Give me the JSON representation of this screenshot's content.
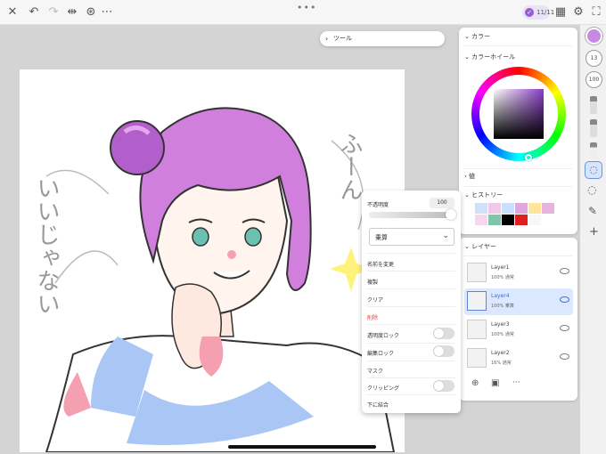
{
  "topbar": {
    "handle": "•••",
    "badge_label": "11/11",
    "icons": [
      "close-icon",
      "undo-icon",
      "redo-icon",
      "flip-icon",
      "filters-icon",
      "more-icon",
      "select-icon",
      "settings-icon",
      "fullscreen-icon"
    ]
  },
  "tools_panel": {
    "label": "ツール"
  },
  "color_panel": {
    "title": "カラー",
    "wheel_title": "カラーホイール",
    "values_title": "値",
    "history_title": "ヒストリー",
    "history_swatches": [
      "#cfe0f7",
      "#f0c9e8",
      "#c8dfff",
      "#e1a6dd",
      "#ffe69a",
      "#e7b4df",
      "#f7d6ee",
      "#7cc7a8",
      "#000000",
      "#e21f1f",
      "#f7f7f7"
    ]
  },
  "layers_panel": {
    "title": "レイヤー",
    "layers": [
      {
        "name": "Layer1",
        "meta": "100%   通常",
        "selected": false
      },
      {
        "name": "Layer4",
        "meta": "100%   乗算",
        "selected": true
      },
      {
        "name": "Layer3",
        "meta": "100%   通常",
        "selected": false
      },
      {
        "name": "Layer2",
        "meta": "16%   通常",
        "selected": false
      }
    ],
    "footer_more": "···"
  },
  "context_menu": {
    "opacity_label": "不透明度",
    "opacity_value": "100",
    "blend_mode": "乗算",
    "items": [
      "名前を変更",
      "複製",
      "クリア",
      "削除",
      "透明度ロック",
      "編集ロック",
      "マスク",
      "クリッピング",
      "下に結合"
    ]
  },
  "right_toolbar": {
    "size_value": "13",
    "opacity_value": "100",
    "add_label": "+"
  },
  "canvas_text": {
    "vertical_1": "ふーん",
    "vertical_2": "いいじゃない"
  },
  "colors": {
    "accent": "#9b5bd6",
    "hair": "#d07fdc",
    "selected_layer": "#dbe8ff",
    "delete_red": "#e14747"
  }
}
